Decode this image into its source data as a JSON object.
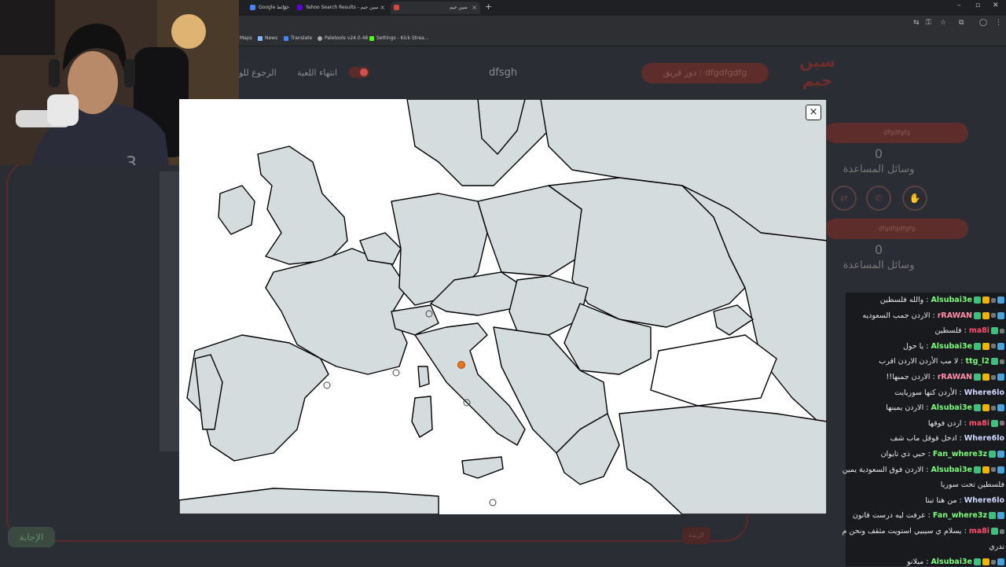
{
  "browser": {
    "tabs": [
      {
        "label": "Google خرائط",
        "favicon_color": "#4285f4"
      },
      {
        "label": "Yahoo Search Results - سين جيم",
        "favicon_color": "#6001d2"
      },
      {
        "label": "سين جيم",
        "favicon_color": "#d9453a"
      }
    ],
    "bookmarks": [
      {
        "label": "Maps",
        "color": "#34a853"
      },
      {
        "label": "News",
        "color": "#8ab4f8"
      },
      {
        "label": "Translate",
        "color": "#4285f4"
      },
      {
        "label": "Paletools v24.0.48",
        "color": "#aaaaaa"
      },
      {
        "label": "Settings - Kick Strea...",
        "color": "#53fc18"
      }
    ]
  },
  "game": {
    "end_game": "انتهاء اللعبة",
    "back": "الرجوع للو",
    "title": "dfsgh",
    "team_turn": "دور فريق : dfgdfgdfg",
    "logo_text": "سين جيم",
    "teams": [
      {
        "name": "dfgdfgfg",
        "score": "0",
        "helpers_label": "وسائل المساعدة"
      },
      {
        "name": "dfgdfgdfgfg",
        "score": "0",
        "helpers_label": "وسائل المساعدة"
      }
    ],
    "answer_label": "الإجابة",
    "small_btn": "الزبدة",
    "close_symbol": "×"
  },
  "webcam": {
    "label": "streamer webcam"
  },
  "chat": {
    "messages": [
      {
        "user": "Alsubai3e",
        "color": "#7cfc7c",
        "text": "والله فلسطين",
        "badges": [
          "b-blue",
          "b-gray",
          "b-yel",
          "b-green"
        ]
      },
      {
        "user": "rRAWAN",
        "color": "#ff8fa8",
        "text": "الاردن جمب السعوديه",
        "badges": [
          "b-blue",
          "b-gray",
          "b-yel",
          "b-green"
        ]
      },
      {
        "user": "ma8i",
        "color": "#ff4f6f",
        "text": "فلسطين",
        "badges": [
          "b-gray",
          "b-green"
        ]
      },
      {
        "user": "Alsubai3e",
        "color": "#7cfc7c",
        "text": "يا حول",
        "badges": [
          "b-blue",
          "b-gray",
          "b-yel",
          "b-green"
        ]
      },
      {
        "user": "ttg_l2",
        "color": "#7cfc7c",
        "text": "لا مب الأردن الاردن اقرب",
        "badges": [
          "b-gray",
          "b-green"
        ]
      },
      {
        "user": "rRAWAN",
        "color": "#ff8fa8",
        "text": "الاردن جمبها!!",
        "badges": [
          "b-blue",
          "b-gray",
          "b-yel",
          "b-green"
        ]
      },
      {
        "user": "Where6lo",
        "color": "#d0d8ff",
        "text": "الأردن كنها سوريايت",
        "badges": []
      },
      {
        "user": "Alsubai3e",
        "color": "#7cfc7c",
        "text": "الاردن يمينها",
        "badges": [
          "b-blue",
          "b-gray",
          "b-yel",
          "b-green"
        ]
      },
      {
        "user": "ma8i",
        "color": "#ff4f6f",
        "text": "اردن فوقها",
        "badges": [
          "b-gray",
          "b-green"
        ]
      },
      {
        "user": "Where6lo",
        "color": "#d0d8ff",
        "text": "ادخل قوقل ماب شف",
        "badges": []
      },
      {
        "user": "Fan_where3z",
        "color": "#7cfc7c",
        "text": "حبي ذي تايوان",
        "badges": [
          "b-blue",
          "b-green"
        ]
      },
      {
        "user": "Alsubai3e",
        "color": "#7cfc7c",
        "text": "الاردن فوق السعودية يمين",
        "badges": [
          "b-blue",
          "b-gray",
          "b-yel",
          "b-green"
        ]
      },
      {
        "user": "",
        "color": "#e8e8e8",
        "text": "فلسطين تحت سوريا",
        "badges": []
      },
      {
        "user": "Where6lo",
        "color": "#d0d8ff",
        "text": "من هنا تبتا",
        "badges": []
      },
      {
        "user": "Fan_where3z",
        "color": "#7cfc7c",
        "text": "عرفت ليه درست قانون",
        "badges": [
          "b-blue",
          "b-green"
        ]
      },
      {
        "user": "ma8i",
        "color": "#ff4f6f",
        "text": "يسلام ي سيبيي استويت مثقف ونحن م",
        "badges": [
          "b-gray",
          "b-green"
        ]
      },
      {
        "user": "",
        "color": "#e8e8e8",
        "text": "ندري",
        "badges": []
      },
      {
        "user": "Alsubai3e",
        "color": "#7cfc7c",
        "text": "ميلانو",
        "badges": [
          "b-blue",
          "b-gray",
          "b-yel",
          "b-green"
        ]
      }
    ]
  }
}
